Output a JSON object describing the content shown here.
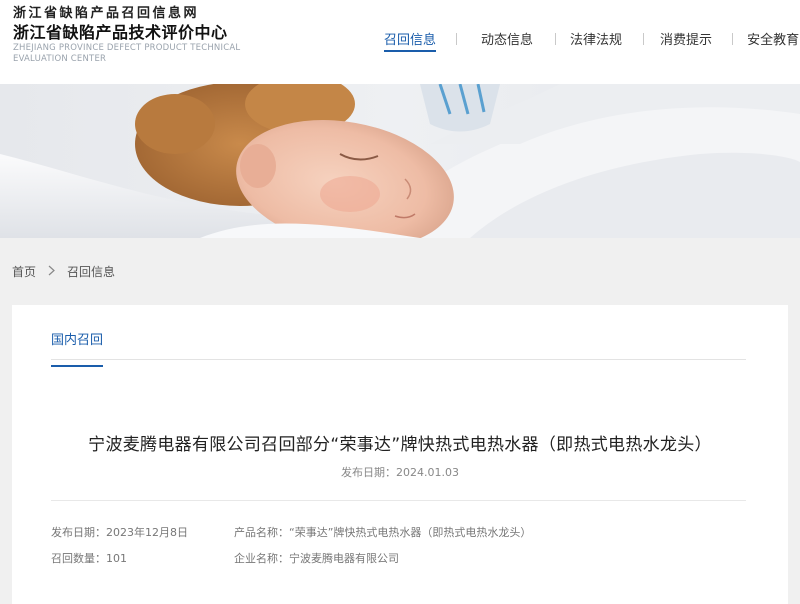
{
  "header": {
    "site_name": "浙江省缺陷产品召回信息网",
    "org_name": "浙江省缺陷产品技术评价中心",
    "org_name_en_line1": "ZHEJIANG PROVINCE DEFECT PRODUCT TECHNICAL",
    "org_name_en_line2": "EVALUATION CENTER"
  },
  "nav": {
    "items": [
      {
        "label": "召回信息",
        "active": true
      },
      {
        "label": "动态信息"
      },
      {
        "label": "法律法规"
      },
      {
        "label": "消费提示"
      },
      {
        "label": "安全教育"
      }
    ]
  },
  "breadcrumb": {
    "home": "首页",
    "current": "召回信息"
  },
  "tabs": {
    "domestic": "国内召回"
  },
  "article": {
    "title": "宁波麦腾电器有限公司召回部分“荣事达”牌快热式电热水器（即热式电热水龙头）",
    "publish_date_label": "发布日期：",
    "publish_date": "2024.01.03",
    "release_date_label": "发布日期：",
    "release_date": "2023年12月8日",
    "recall_qty_label": "召回数量：",
    "recall_qty": "101",
    "product_name_label": "产品名称：",
    "product_name": "“荣事达”牌快热式电热水器（即热式电热水龙头）",
    "company_label": "企业名称：",
    "company": "宁波麦腾电器有限公司"
  },
  "colors": {
    "accent": "#1a5dab",
    "page_bg": "#f0f0f0",
    "card_bg": "#ffffff"
  }
}
